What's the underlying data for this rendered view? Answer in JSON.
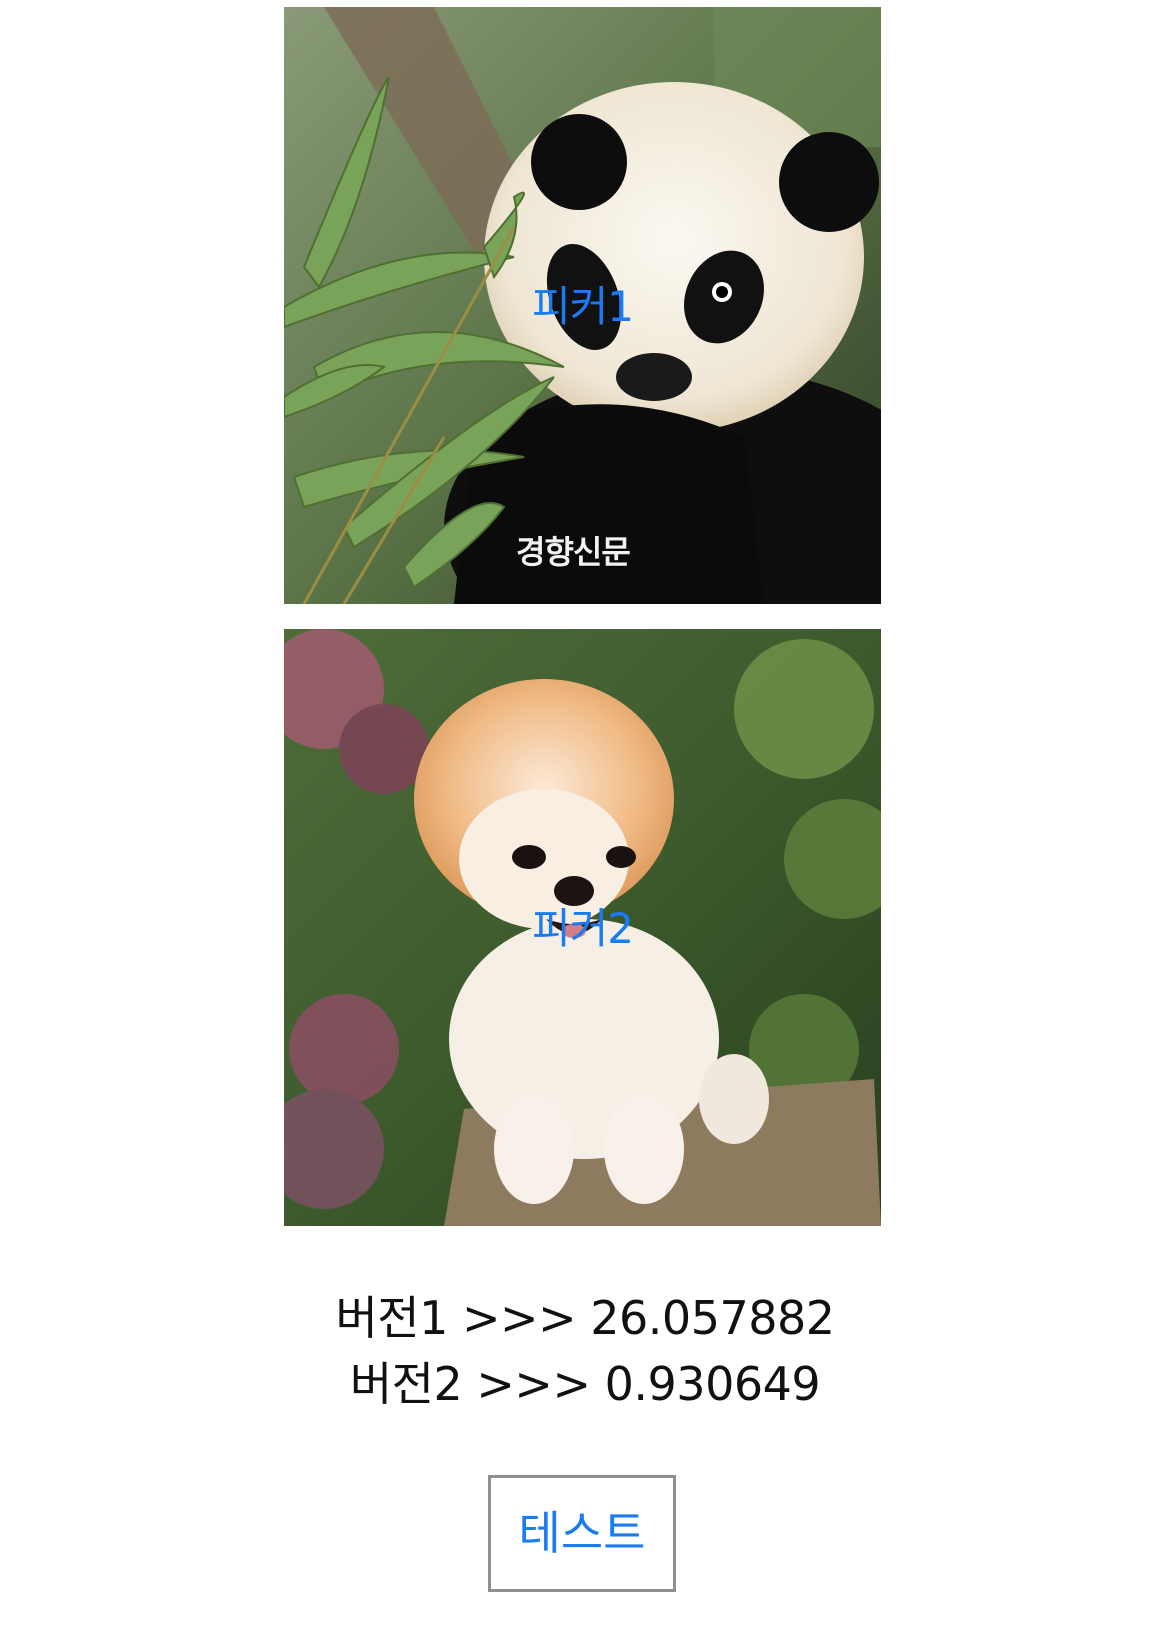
{
  "pickers": [
    {
      "label": "피커1",
      "image": "panda-eating-bamboo",
      "watermark": "경향신문"
    },
    {
      "label": "피커2",
      "image": "pomeranian-dog"
    }
  ],
  "results": {
    "version1_label": "버전1",
    "version1_value": "26.057882",
    "version2_label": "버전2",
    "version2_value": "0.930649",
    "separator": ">>>"
  },
  "test_button": {
    "label": "테스트"
  },
  "colors": {
    "accent": "#1a7cf2",
    "button_border": "#8e8e93",
    "text": "#111111",
    "background": "#ffffff"
  }
}
